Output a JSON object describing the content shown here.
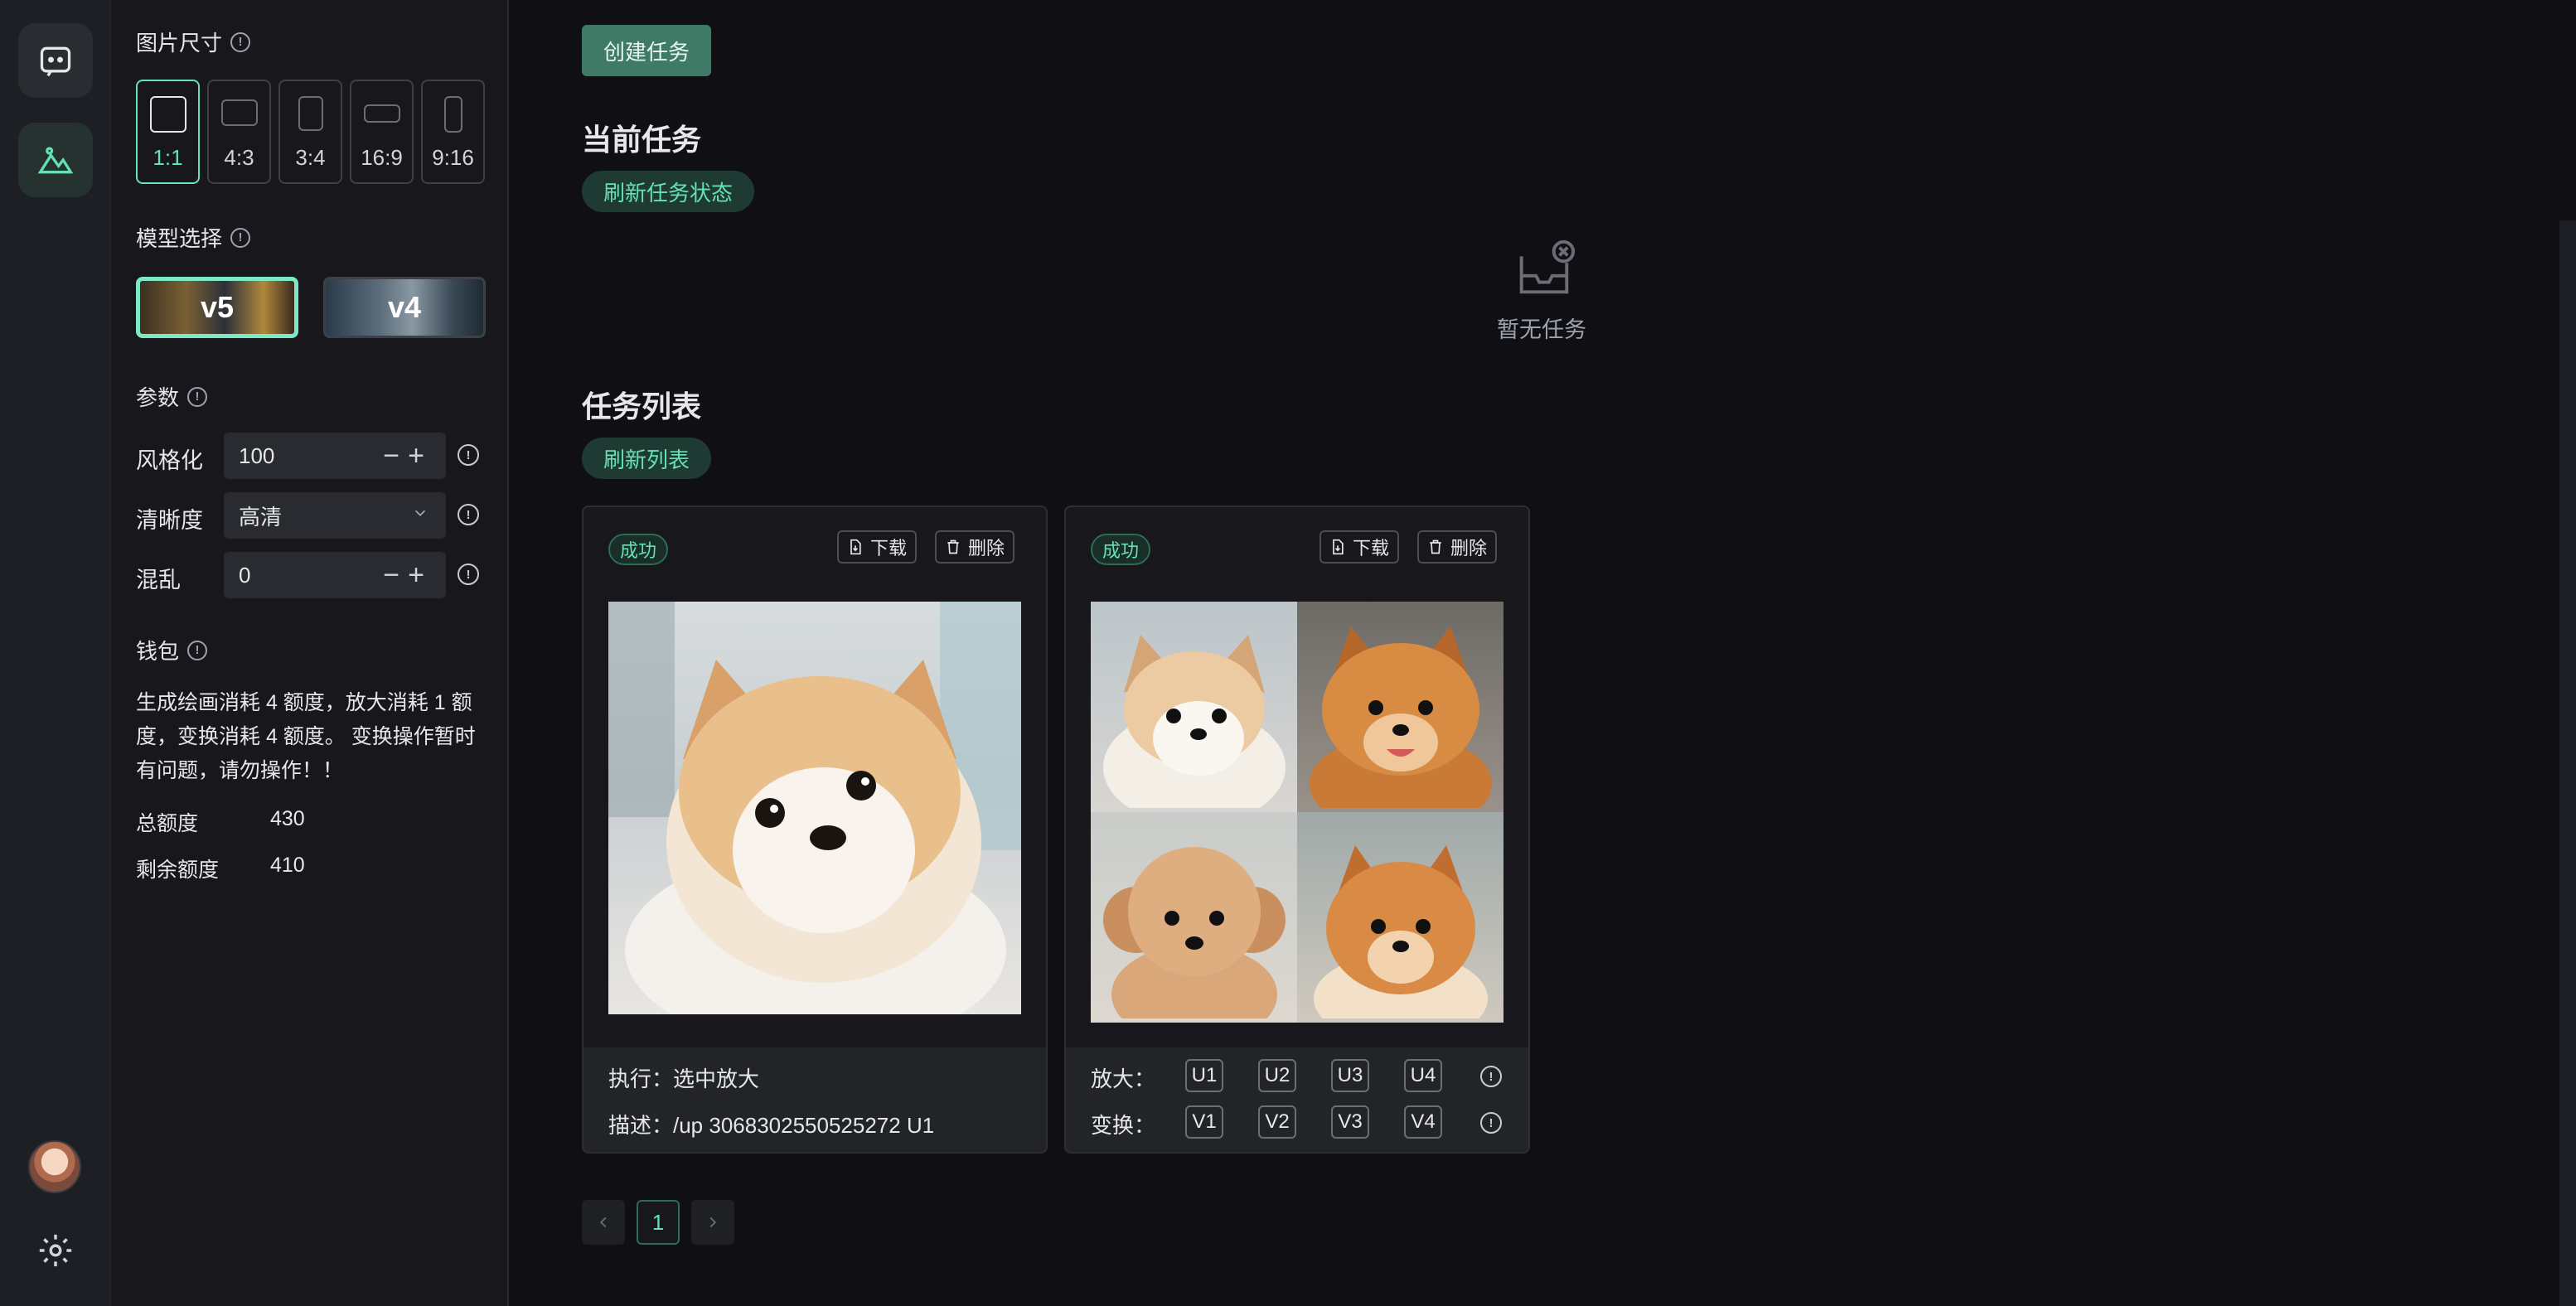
{
  "sidebar": {
    "image_size_label": "图片尺寸",
    "ratios": [
      "1:1",
      "4:3",
      "3:4",
      "16:9",
      "9:16"
    ],
    "selected_ratio": "1:1",
    "model_label": "模型选择",
    "models": [
      "v5",
      "v4"
    ],
    "selected_model": "v5",
    "params_label": "参数",
    "stylize_label": "风格化",
    "stylize_value": "100",
    "quality_label": "清晰度",
    "quality_value": "高清",
    "chaos_label": "混乱",
    "chaos_value": "0",
    "wallet_label": "钱包",
    "wallet_desc": "生成绘画消耗 4 额度，放大消耗 1 额度，变换消耗 4 额度。 变换操作暂时有问题，请勿操作！！",
    "total_label": "总额度",
    "total_value": "430",
    "remaining_label": "剩余额度",
    "remaining_value": "410"
  },
  "main": {
    "create_button": "创建任务",
    "current_title": "当前任务",
    "refresh_status": "刷新任务状态",
    "empty_text": "暂无任务",
    "list_title": "任务列表",
    "refresh_list": "刷新列表",
    "cards": [
      {
        "status": "成功",
        "download": "下载",
        "delete": "删除",
        "exec_line": "执行：选中放大",
        "desc_line": "描述：/up 3068302550525272 U1"
      },
      {
        "status": "成功",
        "download": "下载",
        "delete": "删除",
        "upscale_label": "放大：",
        "variation_label": "变换：",
        "upscale": [
          "U1",
          "U2",
          "U3",
          "U4"
        ],
        "variation": [
          "V1",
          "V2",
          "V3",
          "V4"
        ]
      }
    ],
    "pagination": {
      "current": "1"
    }
  },
  "colors": {
    "accent": "#63e2b7",
    "bg": "#101014",
    "panel": "#18181c"
  }
}
